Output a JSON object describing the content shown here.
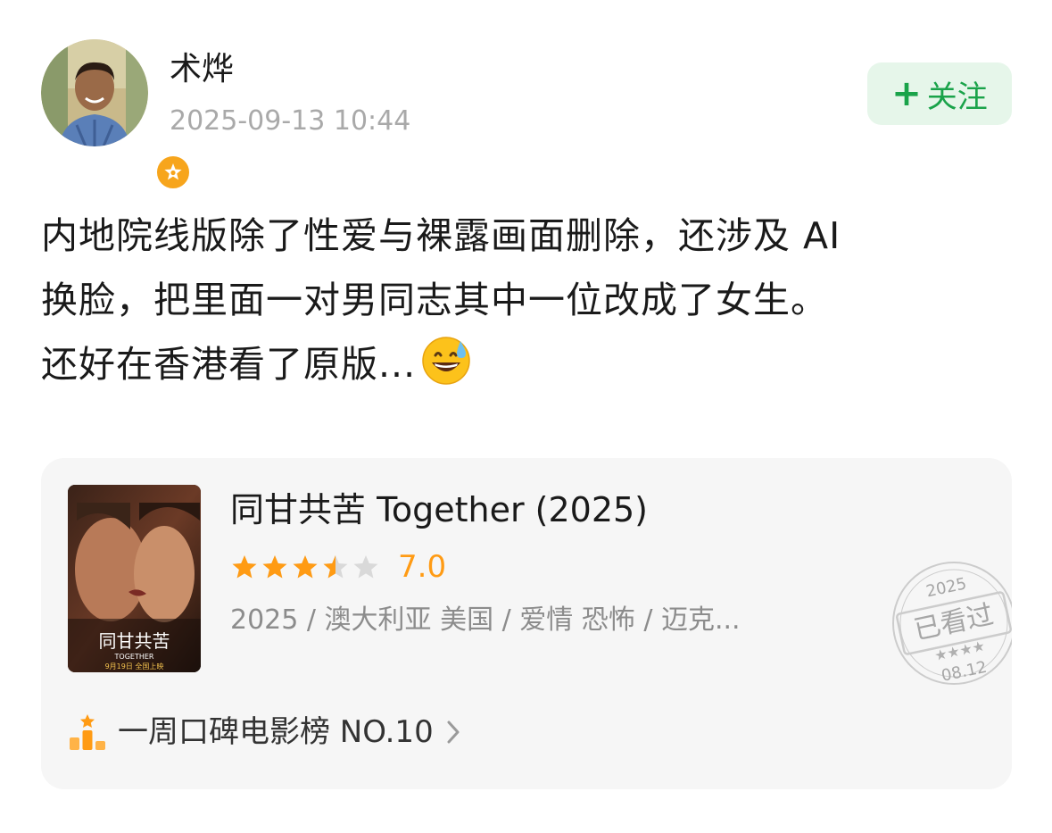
{
  "user": {
    "name": "术烨",
    "timestamp": "2025-09-13 10:44"
  },
  "follow_button": {
    "plus": "+",
    "label": "关注"
  },
  "post": {
    "lines": [
      "内地院线版除了性爱与裸露画面删除，还涉及 AI",
      "换脸，把里面一对男同志其中一位改成了女生。",
      "还好在香港看了原版..."
    ],
    "emoji": "grinning-face-with-sweat"
  },
  "movie_card": {
    "title": "同甘共苦 Together (2025)",
    "rating": "7.0",
    "rating_stars": 3.5,
    "rating_stars_max": 5,
    "meta": "2025 / 澳大利亚 美国 / 爱情 恐怖 / 迈克...",
    "poster_title": "同甘共苦",
    "poster_subtitle": "TOGETHER",
    "poster_date": "9月19日 全国上映",
    "rank_label": "一周口碑电影榜 NO.10",
    "stamp": {
      "year": "2025",
      "label": "已看过",
      "date": "08.12"
    }
  },
  "colors": {
    "follow_bg": "#e6f6ea",
    "follow_text": "#1aa34a",
    "star_filled": "#ff9b14",
    "star_empty": "#d9d9d9",
    "card_bg": "#f6f6f6",
    "badge": "#f7a51c"
  }
}
